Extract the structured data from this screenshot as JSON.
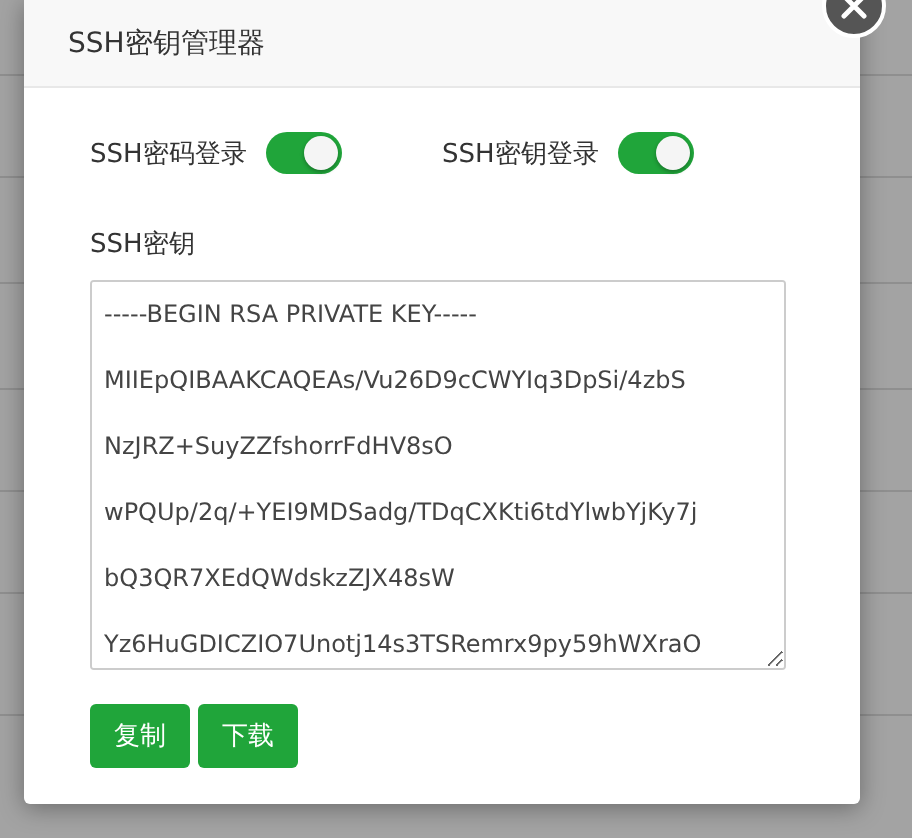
{
  "dialog": {
    "title": "SSH密钥管理器"
  },
  "toggles": [
    {
      "label": "SSH密码登录",
      "on": true
    },
    {
      "label": "SSH密钥登录",
      "on": true
    }
  ],
  "key_field": {
    "label": "SSH密钥",
    "lines": [
      "-----BEGIN RSA PRIVATE KEY-----",
      "MIIEpQIBAAKCAQEAs/Vu26D9cCWYIq3DpSi/4zbS",
      "NzJRZ+SuyZZfshorrFdHV8sO",
      "wPQUp/2q/+YEI9MDSadg/TDqCXKti6tdYlwbYjKy7j",
      "bQ3QR7XEdQWdskzZJX48sW",
      "Yz6HuGDICZIO7Unotj14s3TSRemrx9py59hWXraO"
    ]
  },
  "buttons": [
    {
      "label": "复制"
    },
    {
      "label": "下载"
    }
  ]
}
